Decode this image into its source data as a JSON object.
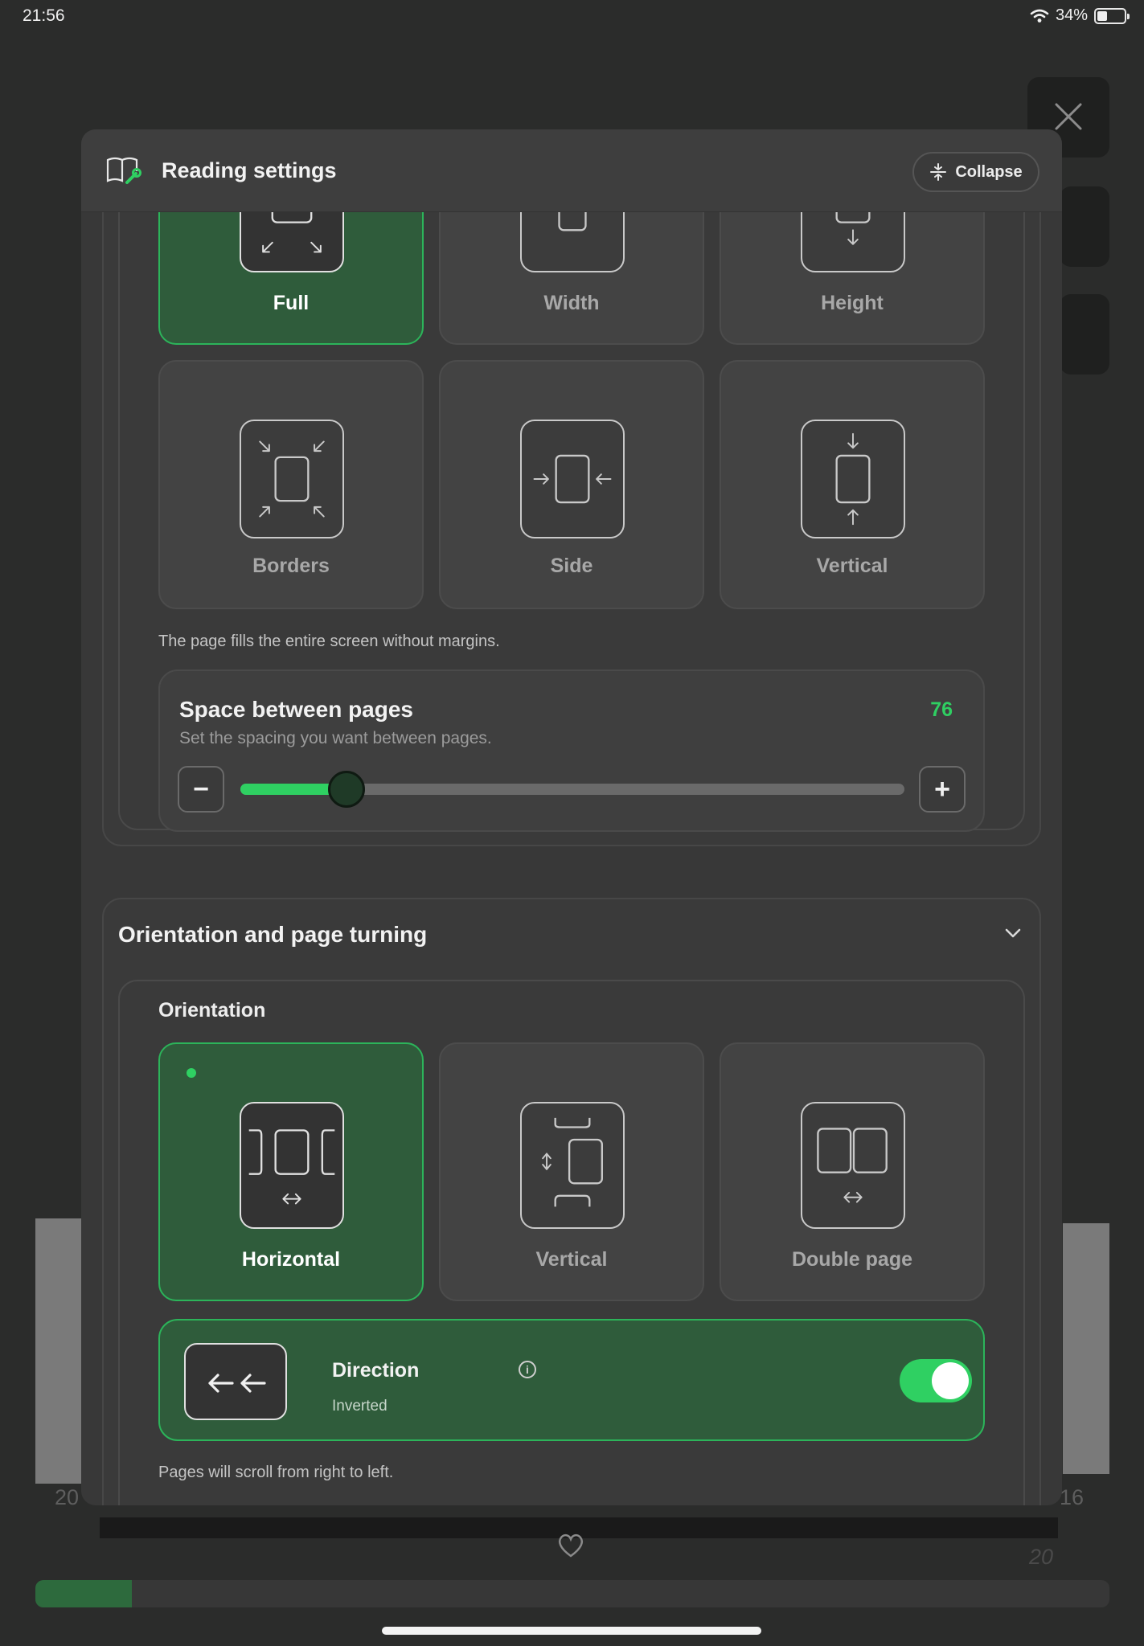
{
  "status": {
    "time": "21:56",
    "battery": "34%",
    "battery_level": 0.34
  },
  "background": {
    "left_number": "20",
    "right_number": "16",
    "bottom_number": "20",
    "reading_progress": 0.09
  },
  "modal": {
    "title": "Reading settings",
    "collapse_label": "Collapse",
    "fit_modes": [
      {
        "label": "Full",
        "selected": true
      },
      {
        "label": "Width",
        "selected": false
      },
      {
        "label": "Height",
        "selected": false
      },
      {
        "label": "Borders",
        "selected": false
      },
      {
        "label": "Side",
        "selected": false
      },
      {
        "label": "Vertical",
        "selected": false
      }
    ],
    "fit_description": "The page fills the entire screen without margins.",
    "spacing": {
      "title": "Space between pages",
      "subtitle": "Set the spacing you want between pages.",
      "value": "76",
      "level": 0.16,
      "minus": "−",
      "plus": "+"
    },
    "orientation_section": {
      "title": "Orientation and page turning",
      "subtitle": "Orientation",
      "options": [
        {
          "label": "Horizontal",
          "selected": true
        },
        {
          "label": "Vertical",
          "selected": false
        },
        {
          "label": "Double page",
          "selected": false
        }
      ],
      "direction": {
        "title": "Direction",
        "value": "Inverted",
        "enabled": true
      },
      "description": "Pages will scroll from right to left."
    }
  },
  "colors": {
    "accent": "#2fd062",
    "selected_bg": "#2f5c3b",
    "panel": "#383838"
  }
}
